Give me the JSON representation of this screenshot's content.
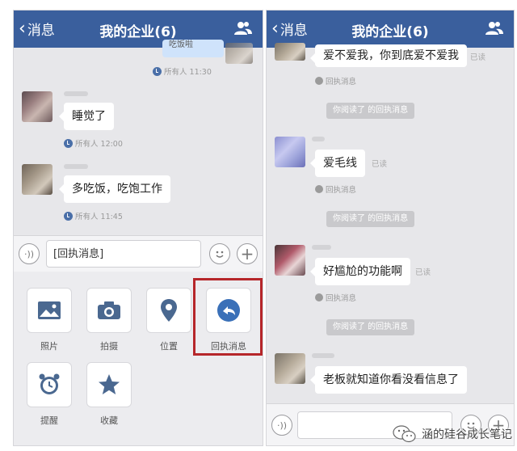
{
  "left_screen": {
    "nav": {
      "back_label": "消息",
      "title": "我的企业(6)",
      "contacts_icon": "contacts-icon"
    },
    "top_partial": {
      "text": "吃饭啦",
      "receipt": "所有人 11:30"
    },
    "messages": [
      {
        "text": "睡觉了",
        "receipt": "所有人 12:00"
      },
      {
        "text": "多吃饭，吃饱工作",
        "receipt": "所有人 11:45"
      }
    ],
    "input": {
      "value": "[回执消息]"
    },
    "panel": {
      "items": [
        {
          "label": "照片",
          "icon": "photo-icon"
        },
        {
          "label": "拍摄",
          "icon": "camera-icon"
        },
        {
          "label": "位置",
          "icon": "location-icon"
        },
        {
          "label": "回执消息",
          "icon": "receipt-message-icon"
        },
        {
          "label": "提醒",
          "icon": "alarm-icon"
        },
        {
          "label": "收藏",
          "icon": "star-icon"
        }
      ],
      "highlight_color": "#b6262a"
    }
  },
  "right_screen": {
    "nav": {
      "back_label": "消息",
      "title": "我的企业(6)",
      "contacts_icon": "contacts-icon"
    },
    "messages": [
      {
        "text": "爱不爱我，你到底爱不爱我",
        "status": "已读",
        "receipt_label": "回执消息",
        "notice": "你阅读了        的回执消息"
      },
      {
        "text": "爱毛线",
        "status": "已读",
        "receipt_label": "回执消息",
        "notice": "你阅读了        的回执消息"
      },
      {
        "text": "好尴尬的功能啊",
        "status": "已读",
        "receipt_label": "回执消息",
        "notice": "你阅读了        的回执消息"
      },
      {
        "text": "老板就知道你看没看信息了"
      }
    ]
  },
  "watermark": {
    "text": "涵的硅谷成长笔记"
  },
  "colors": {
    "nav_bg": "#3a5f9d",
    "chat_bg": "#e7e7ea",
    "accent": "#3a5f9d"
  }
}
